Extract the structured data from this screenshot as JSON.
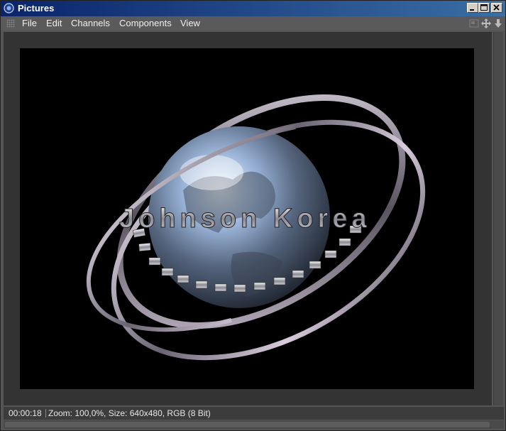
{
  "window": {
    "title": "Pictures"
  },
  "menu": [
    {
      "label": "File"
    },
    {
      "label": "Edit"
    },
    {
      "label": "Channels"
    },
    {
      "label": "Components"
    },
    {
      "label": "View"
    }
  ],
  "picture": {
    "overlay_text": "Johnson Korea"
  },
  "status": {
    "time": "00:00:18",
    "info": "Zoom: 100,0%, Size: 640x480, RGB (8 Bit)"
  },
  "colors": {
    "title_active": "#0a246a",
    "canvas": "#000000",
    "panel": "#555555"
  },
  "icons": [
    "app-icon",
    "minimize-icon",
    "maximize-icon",
    "close-icon",
    "grip-icon",
    "view-icon",
    "move-icon",
    "download-icon"
  ]
}
